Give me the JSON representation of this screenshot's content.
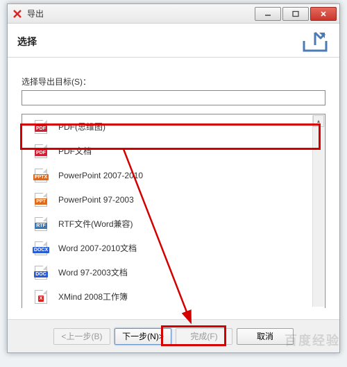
{
  "titlebar": {
    "title": "导出"
  },
  "header": {
    "heading": "选择"
  },
  "form": {
    "label": "选择导出目标(S)：",
    "value": ""
  },
  "list": {
    "items": [
      {
        "label": "PDF(思维图)",
        "badge": "PDF",
        "color": "#c23"
      },
      {
        "label": "PDF文档",
        "badge": "PDF",
        "color": "#c23"
      },
      {
        "label": "PowerPoint 2007-2010",
        "badge": "PPTX",
        "color": "#e06a19"
      },
      {
        "label": "PowerPoint 97-2003",
        "badge": "PPT",
        "color": "#e06a19"
      },
      {
        "label": "RTF文件(Word兼容)",
        "badge": "RTF",
        "color": "#3c78b4"
      },
      {
        "label": "Word 2007-2010文档",
        "badge": "DOCX",
        "color": "#2a5bd7"
      },
      {
        "label": "Word 97-2003文档",
        "badge": "DOC",
        "color": "#2a5bd7"
      },
      {
        "label": "XMind 2008工作簿",
        "badge": "X",
        "color": "#d22"
      }
    ]
  },
  "footer": {
    "back": "<上一步(B)",
    "next": "下一步(N)>",
    "finish": "完成(F)",
    "cancel": "取消"
  },
  "watermark": "百度经验"
}
